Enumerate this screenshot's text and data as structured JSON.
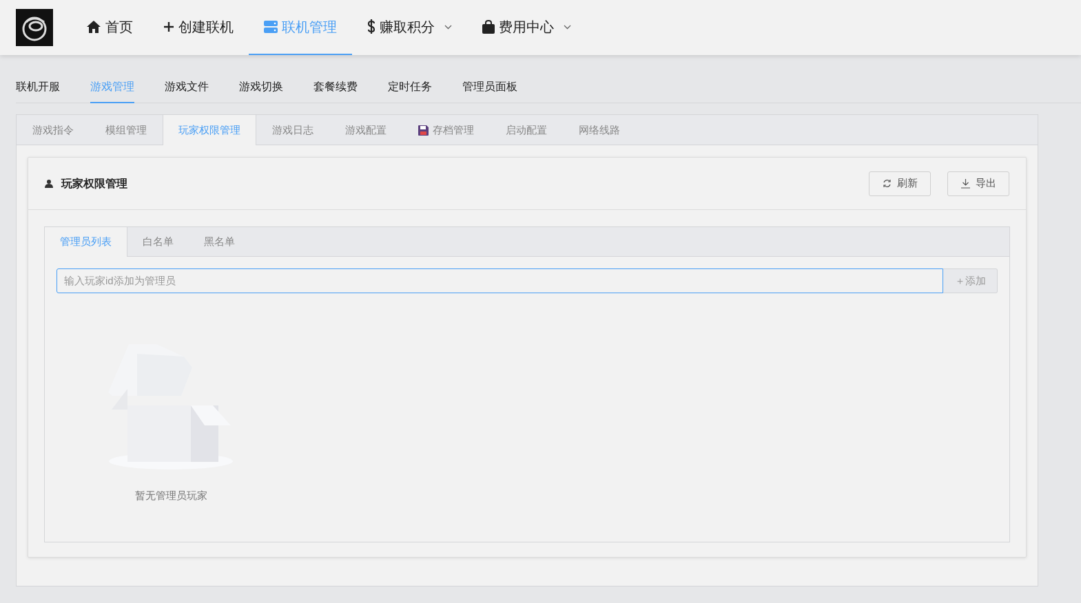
{
  "nav": [
    {
      "label": "首页",
      "selected": false,
      "dropdown": false
    },
    {
      "label": "创建联机",
      "selected": false,
      "dropdown": false
    },
    {
      "label": "联机管理",
      "selected": true,
      "dropdown": false
    },
    {
      "label": "赚取积分",
      "selected": false,
      "dropdown": true
    },
    {
      "label": "费用中心",
      "selected": false,
      "dropdown": true
    }
  ],
  "sub_tabs": [
    {
      "label": "联机开服",
      "selected": false
    },
    {
      "label": "游戏管理",
      "selected": true
    },
    {
      "label": "游戏文件",
      "selected": false
    },
    {
      "label": "游戏切换",
      "selected": false
    },
    {
      "label": "套餐续费",
      "selected": false
    },
    {
      "label": "定时任务",
      "selected": false
    },
    {
      "label": "管理员面板",
      "selected": false
    }
  ],
  "card_tabs": [
    {
      "label": "游戏指令",
      "selected": false
    },
    {
      "label": "模组管理",
      "selected": false
    },
    {
      "label": "玩家权限管理",
      "selected": true
    },
    {
      "label": "游戏日志",
      "selected": false
    },
    {
      "label": "游戏配置",
      "selected": false
    },
    {
      "label": "存档管理",
      "selected": false
    },
    {
      "label": "启动配置",
      "selected": false
    },
    {
      "label": "网络线路",
      "selected": false
    }
  ],
  "panel": {
    "title": "玩家权限管理",
    "buttons": [
      "刷新",
      "导出"
    ],
    "tabs": [
      {
        "label": "管理员列表",
        "selected": true
      },
      {
        "label": "白名单",
        "selected": false
      },
      {
        "label": "黑名单",
        "selected": false
      }
    ],
    "input": {
      "placeholder": "输入玩家id添加为管理员",
      "button": "＋添加"
    },
    "empty_text": "暂无管理员玩家"
  }
}
